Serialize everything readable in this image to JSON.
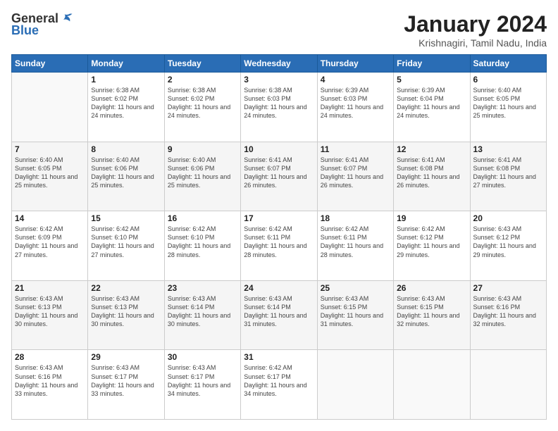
{
  "header": {
    "logo_general": "General",
    "logo_blue": "Blue",
    "title": "January 2024",
    "subtitle": "Krishnagiri, Tamil Nadu, India"
  },
  "days_of_week": [
    "Sunday",
    "Monday",
    "Tuesday",
    "Wednesday",
    "Thursday",
    "Friday",
    "Saturday"
  ],
  "weeks": [
    [
      {
        "day": "",
        "sunrise": "",
        "sunset": "",
        "daylight": ""
      },
      {
        "day": "1",
        "sunrise": "Sunrise: 6:38 AM",
        "sunset": "Sunset: 6:02 PM",
        "daylight": "Daylight: 11 hours and 24 minutes."
      },
      {
        "day": "2",
        "sunrise": "Sunrise: 6:38 AM",
        "sunset": "Sunset: 6:02 PM",
        "daylight": "Daylight: 11 hours and 24 minutes."
      },
      {
        "day": "3",
        "sunrise": "Sunrise: 6:38 AM",
        "sunset": "Sunset: 6:03 PM",
        "daylight": "Daylight: 11 hours and 24 minutes."
      },
      {
        "day": "4",
        "sunrise": "Sunrise: 6:39 AM",
        "sunset": "Sunset: 6:03 PM",
        "daylight": "Daylight: 11 hours and 24 minutes."
      },
      {
        "day": "5",
        "sunrise": "Sunrise: 6:39 AM",
        "sunset": "Sunset: 6:04 PM",
        "daylight": "Daylight: 11 hours and 24 minutes."
      },
      {
        "day": "6",
        "sunrise": "Sunrise: 6:40 AM",
        "sunset": "Sunset: 6:05 PM",
        "daylight": "Daylight: 11 hours and 25 minutes."
      }
    ],
    [
      {
        "day": "7",
        "sunrise": "Sunrise: 6:40 AM",
        "sunset": "Sunset: 6:05 PM",
        "daylight": "Daylight: 11 hours and 25 minutes."
      },
      {
        "day": "8",
        "sunrise": "Sunrise: 6:40 AM",
        "sunset": "Sunset: 6:06 PM",
        "daylight": "Daylight: 11 hours and 25 minutes."
      },
      {
        "day": "9",
        "sunrise": "Sunrise: 6:40 AM",
        "sunset": "Sunset: 6:06 PM",
        "daylight": "Daylight: 11 hours and 25 minutes."
      },
      {
        "day": "10",
        "sunrise": "Sunrise: 6:41 AM",
        "sunset": "Sunset: 6:07 PM",
        "daylight": "Daylight: 11 hours and 26 minutes."
      },
      {
        "day": "11",
        "sunrise": "Sunrise: 6:41 AM",
        "sunset": "Sunset: 6:07 PM",
        "daylight": "Daylight: 11 hours and 26 minutes."
      },
      {
        "day": "12",
        "sunrise": "Sunrise: 6:41 AM",
        "sunset": "Sunset: 6:08 PM",
        "daylight": "Daylight: 11 hours and 26 minutes."
      },
      {
        "day": "13",
        "sunrise": "Sunrise: 6:41 AM",
        "sunset": "Sunset: 6:08 PM",
        "daylight": "Daylight: 11 hours and 27 minutes."
      }
    ],
    [
      {
        "day": "14",
        "sunrise": "Sunrise: 6:42 AM",
        "sunset": "Sunset: 6:09 PM",
        "daylight": "Daylight: 11 hours and 27 minutes."
      },
      {
        "day": "15",
        "sunrise": "Sunrise: 6:42 AM",
        "sunset": "Sunset: 6:10 PM",
        "daylight": "Daylight: 11 hours and 27 minutes."
      },
      {
        "day": "16",
        "sunrise": "Sunrise: 6:42 AM",
        "sunset": "Sunset: 6:10 PM",
        "daylight": "Daylight: 11 hours and 28 minutes."
      },
      {
        "day": "17",
        "sunrise": "Sunrise: 6:42 AM",
        "sunset": "Sunset: 6:11 PM",
        "daylight": "Daylight: 11 hours and 28 minutes."
      },
      {
        "day": "18",
        "sunrise": "Sunrise: 6:42 AM",
        "sunset": "Sunset: 6:11 PM",
        "daylight": "Daylight: 11 hours and 28 minutes."
      },
      {
        "day": "19",
        "sunrise": "Sunrise: 6:42 AM",
        "sunset": "Sunset: 6:12 PM",
        "daylight": "Daylight: 11 hours and 29 minutes."
      },
      {
        "day": "20",
        "sunrise": "Sunrise: 6:43 AM",
        "sunset": "Sunset: 6:12 PM",
        "daylight": "Daylight: 11 hours and 29 minutes."
      }
    ],
    [
      {
        "day": "21",
        "sunrise": "Sunrise: 6:43 AM",
        "sunset": "Sunset: 6:13 PM",
        "daylight": "Daylight: 11 hours and 30 minutes."
      },
      {
        "day": "22",
        "sunrise": "Sunrise: 6:43 AM",
        "sunset": "Sunset: 6:13 PM",
        "daylight": "Daylight: 11 hours and 30 minutes."
      },
      {
        "day": "23",
        "sunrise": "Sunrise: 6:43 AM",
        "sunset": "Sunset: 6:14 PM",
        "daylight": "Daylight: 11 hours and 30 minutes."
      },
      {
        "day": "24",
        "sunrise": "Sunrise: 6:43 AM",
        "sunset": "Sunset: 6:14 PM",
        "daylight": "Daylight: 11 hours and 31 minutes."
      },
      {
        "day": "25",
        "sunrise": "Sunrise: 6:43 AM",
        "sunset": "Sunset: 6:15 PM",
        "daylight": "Daylight: 11 hours and 31 minutes."
      },
      {
        "day": "26",
        "sunrise": "Sunrise: 6:43 AM",
        "sunset": "Sunset: 6:15 PM",
        "daylight": "Daylight: 11 hours and 32 minutes."
      },
      {
        "day": "27",
        "sunrise": "Sunrise: 6:43 AM",
        "sunset": "Sunset: 6:16 PM",
        "daylight": "Daylight: 11 hours and 32 minutes."
      }
    ],
    [
      {
        "day": "28",
        "sunrise": "Sunrise: 6:43 AM",
        "sunset": "Sunset: 6:16 PM",
        "daylight": "Daylight: 11 hours and 33 minutes."
      },
      {
        "day": "29",
        "sunrise": "Sunrise: 6:43 AM",
        "sunset": "Sunset: 6:17 PM",
        "daylight": "Daylight: 11 hours and 33 minutes."
      },
      {
        "day": "30",
        "sunrise": "Sunrise: 6:43 AM",
        "sunset": "Sunset: 6:17 PM",
        "daylight": "Daylight: 11 hours and 34 minutes."
      },
      {
        "day": "31",
        "sunrise": "Sunrise: 6:42 AM",
        "sunset": "Sunset: 6:17 PM",
        "daylight": "Daylight: 11 hours and 34 minutes."
      },
      {
        "day": "",
        "sunrise": "",
        "sunset": "",
        "daylight": ""
      },
      {
        "day": "",
        "sunrise": "",
        "sunset": "",
        "daylight": ""
      },
      {
        "day": "",
        "sunrise": "",
        "sunset": "",
        "daylight": ""
      }
    ]
  ]
}
